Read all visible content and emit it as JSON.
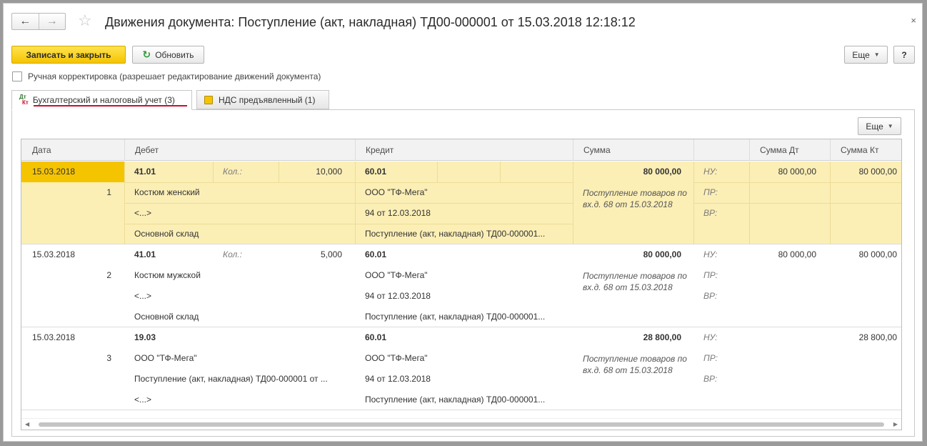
{
  "window": {
    "title": "Движения документа: Поступление (акт, накладная) ТД00-000001 от 15.03.2018 12:18:12",
    "close": "×"
  },
  "nav": {
    "back": "←",
    "forward": "→",
    "favorite": "☆"
  },
  "toolbar": {
    "save_close_label": "Записать и закрыть",
    "refresh_label": "Обновить",
    "more_label": "Еще",
    "help_label": "?"
  },
  "manual_edit": {
    "label": "Ручная корректировка (разрешает редактирование движений документа)",
    "checked": false
  },
  "tabs": [
    {
      "label": "Бухгалтерский и налоговый учет (3)",
      "icon_dt": "Дт",
      "icon_kt": "Кт",
      "active": true
    },
    {
      "label": "НДС предъявленный (1)",
      "active": false
    }
  ],
  "grid": {
    "more_label": "Еще",
    "columns": {
      "date": "Дата",
      "debit": "Дебет",
      "credit": "Кредит",
      "sum": "Сумма",
      "sum_dt": "Сумма Дт",
      "sum_kt": "Сумма Кт"
    },
    "rows": [
      {
        "date": "15.03.2018",
        "n": "1",
        "debit_account": "41.01",
        "qty_label": "Кол.:",
        "qty": "10,000",
        "debit_sub1": "Костюм женский",
        "debit_sub2": "<...>",
        "debit_sub3": "Основной склад",
        "credit_account": "60.01",
        "credit_sub1": "ООО \"ТФ-Мега\"",
        "credit_sub2": "94 от 12.03.2018",
        "credit_sub3": "Поступление (акт, накладная) ТД00-000001...",
        "sum": "80 000,00",
        "description": "Поступление товаров по вх.д. 68 от 15.03.2018",
        "nu": "НУ:",
        "pr": "ПР:",
        "vr": "ВР:",
        "sum_dt": "80 000,00",
        "sum_kt": "80 000,00"
      },
      {
        "date": "15.03.2018",
        "n": "2",
        "debit_account": "41.01",
        "qty_label": "Кол.:",
        "qty": "5,000",
        "debit_sub1": "Костюм мужской",
        "debit_sub2": "<...>",
        "debit_sub3": "Основной склад",
        "credit_account": "60.01",
        "credit_sub1": "ООО \"ТФ-Мега\"",
        "credit_sub2": "94 от 12.03.2018",
        "credit_sub3": "Поступление (акт, накладная) ТД00-000001...",
        "sum": "80 000,00",
        "description": "Поступление товаров по вх.д. 68 от 15.03.2018",
        "nu": "НУ:",
        "pr": "ПР:",
        "vr": "ВР:",
        "sum_dt": "80 000,00",
        "sum_kt": "80 000,00"
      },
      {
        "date": "15.03.2018",
        "n": "3",
        "debit_account": "19.03",
        "qty_label": "",
        "qty": "",
        "debit_sub1": "ООО \"ТФ-Мега\"",
        "debit_sub2": "Поступление (акт, накладная) ТД00-000001 от ...",
        "debit_sub3": "<...>",
        "credit_account": "60.01",
        "credit_sub1": "ООО \"ТФ-Мега\"",
        "credit_sub2": "94 от 12.03.2018",
        "credit_sub3": "Поступление (акт, накладная) ТД00-000001...",
        "sum": "28 800,00",
        "description": "Поступление товаров по вх.д. 68 от 15.03.2018",
        "nu": "НУ:",
        "pr": "ПР:",
        "vr": "ВР:",
        "sum_dt": "",
        "sum_kt": "28 800,00"
      }
    ]
  },
  "colors": {
    "accent_yellow": "#f5c400",
    "selected_row": "#fbefb6",
    "tab_underline": "#c8102e"
  }
}
